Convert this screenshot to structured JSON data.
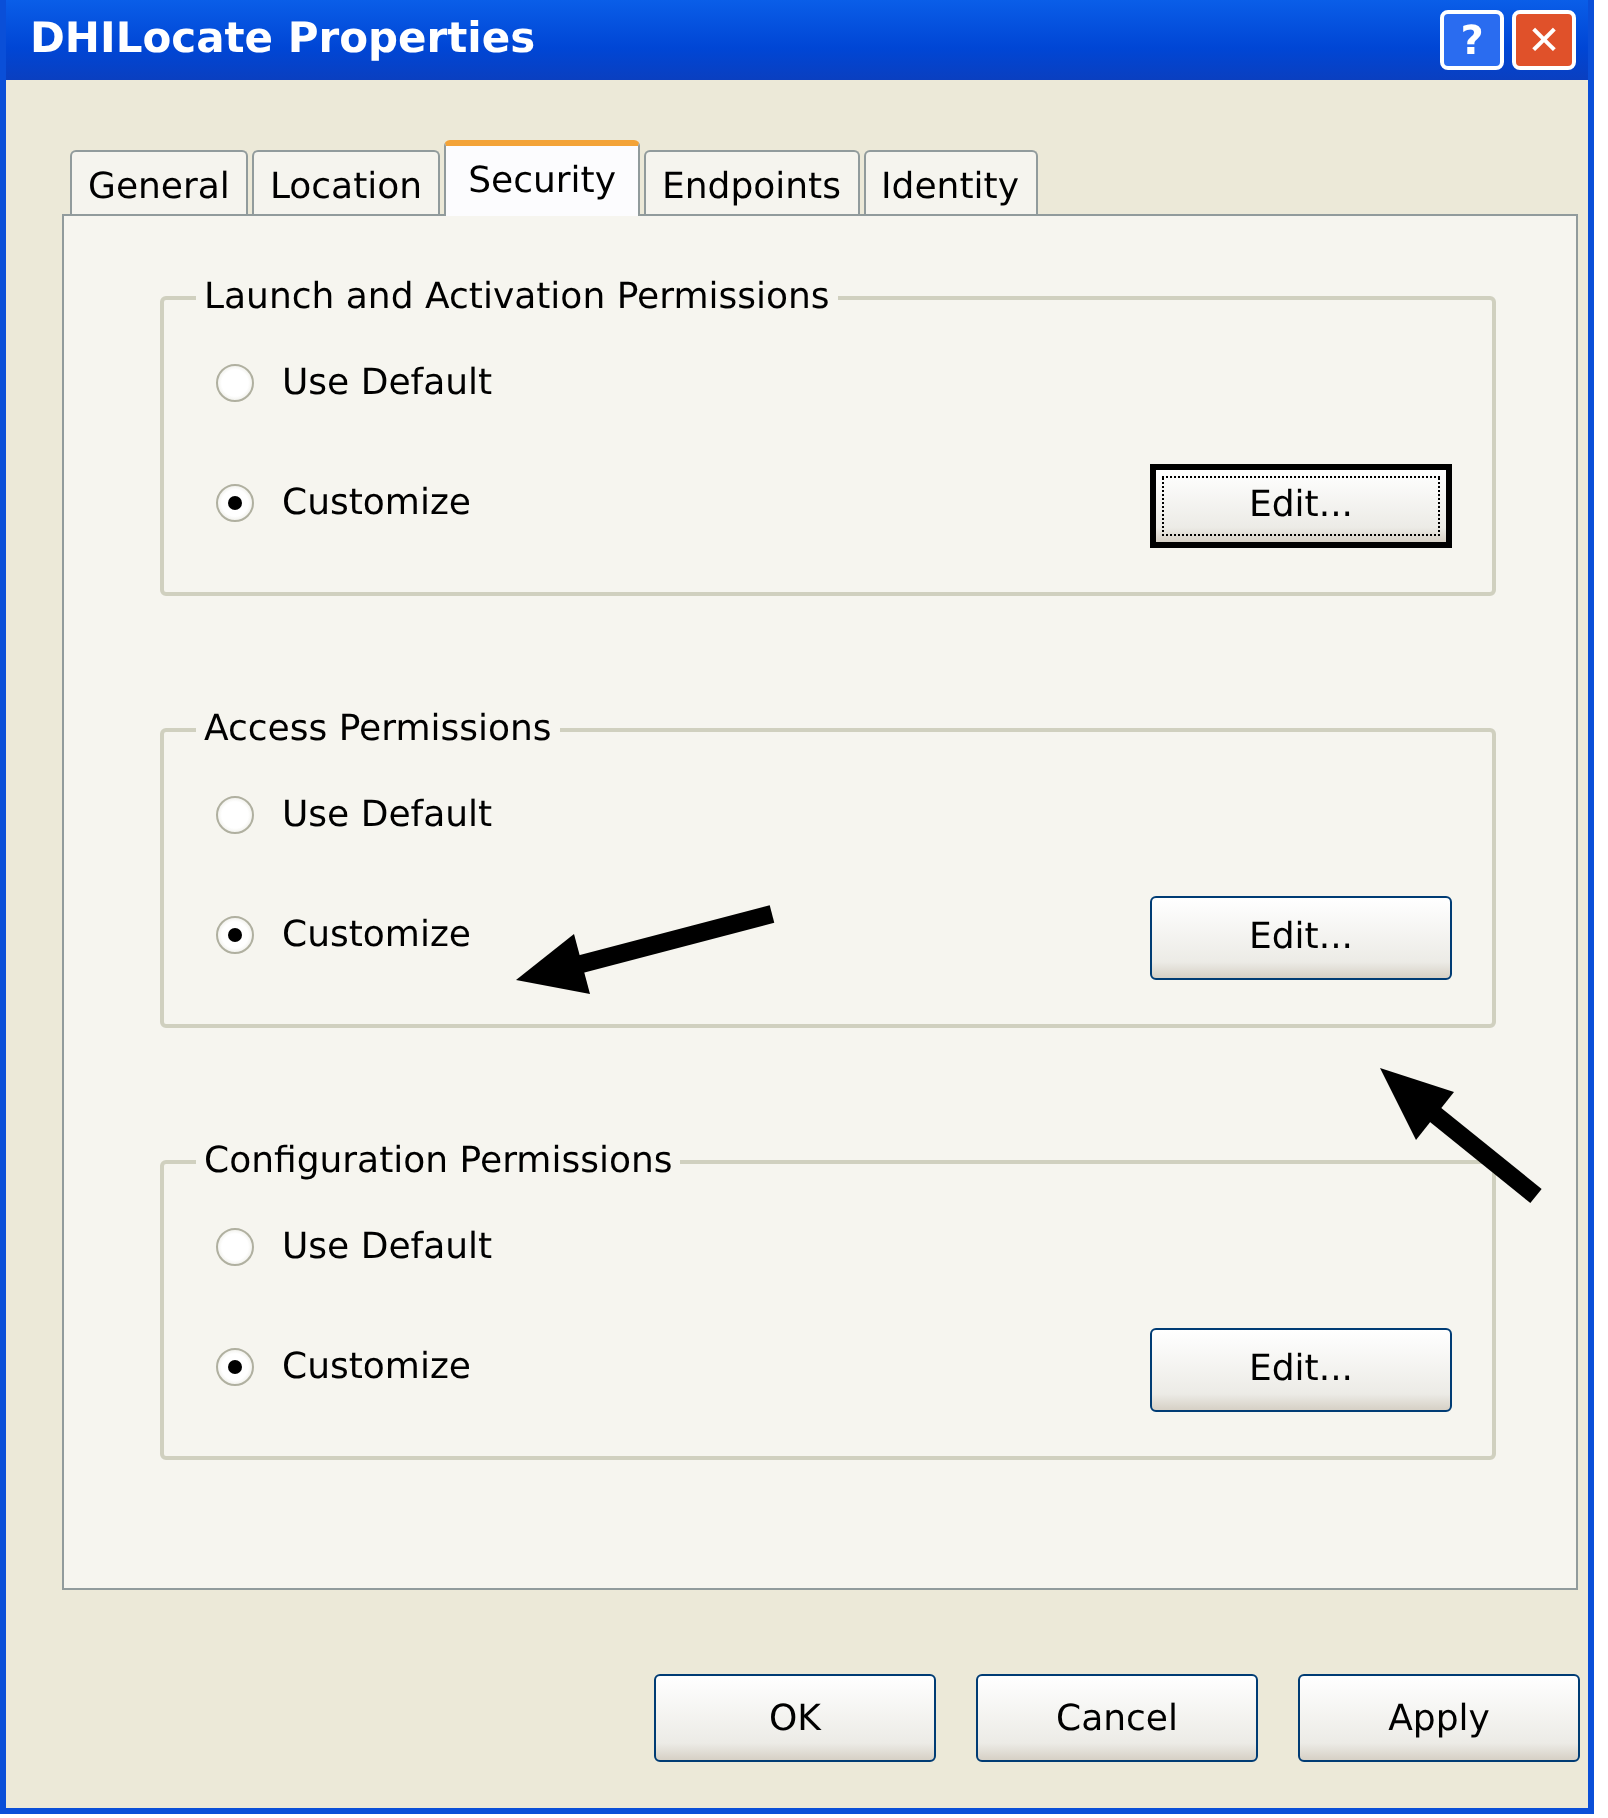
{
  "window": {
    "title": "DHILocate Properties",
    "help_button": "?",
    "close_button": "✕"
  },
  "tabs": [
    {
      "label": "General",
      "selected": false
    },
    {
      "label": "Location",
      "selected": false
    },
    {
      "label": "Security",
      "selected": true
    },
    {
      "label": "Endpoints",
      "selected": false
    },
    {
      "label": "Identity",
      "selected": false
    }
  ],
  "groups": [
    {
      "title": "Launch and Activation Permissions",
      "options": [
        {
          "label": "Use Default",
          "selected": false
        },
        {
          "label": "Customize",
          "selected": true
        }
      ],
      "button": {
        "label": "Edit...",
        "focused": true
      }
    },
    {
      "title": "Access Permissions",
      "options": [
        {
          "label": "Use Default",
          "selected": false
        },
        {
          "label": "Customize",
          "selected": true
        }
      ],
      "button": {
        "label": "Edit...",
        "focused": false
      }
    },
    {
      "title": "Configuration Permissions",
      "options": [
        {
          "label": "Use Default",
          "selected": false
        },
        {
          "label": "Customize",
          "selected": true
        }
      ],
      "button": {
        "label": "Edit...",
        "focused": false
      }
    }
  ],
  "buttons": [
    "OK",
    "Cancel",
    "Apply"
  ]
}
